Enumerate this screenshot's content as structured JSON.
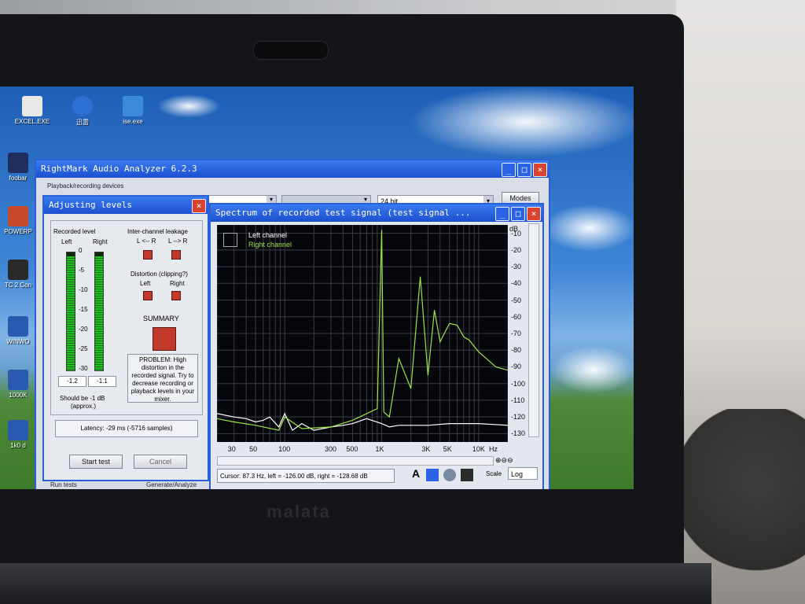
{
  "desktop_icons": [
    {
      "label": "EXCEL.EXE"
    },
    {
      "label": "迅雷"
    },
    {
      "label": "ise.exe"
    },
    {
      "label": "foobar"
    },
    {
      "label": "POWERP"
    },
    {
      "label": "TC 2 Con"
    },
    {
      "label": "WINWO"
    },
    {
      "label": "1000K"
    },
    {
      "label": "1k0 d"
    }
  ],
  "main_window": {
    "title": "RightMark Audio Analyzer 6.2.3",
    "playback_group": "Playback/recording devices",
    "bitdepth": "24 bit",
    "modes_button": "Modes",
    "run_tests": "Run tests",
    "generate_analyze": "Generate/Analyze"
  },
  "levels_window": {
    "title": "Adjusting levels",
    "recorded_level": "Recorded level",
    "left": "Left",
    "right": "Right",
    "scale": [
      "0",
      "-5",
      "-10",
      "-15",
      "-20",
      "-25",
      "-30"
    ],
    "left_value": "-1.2",
    "right_value": "-1.1",
    "left_level_fraction": 0.97,
    "right_level_fraction": 0.97,
    "should_be": "Should be  -1 dB",
    "approx": "(approx.)",
    "leakage_label": "Inter-channel leakage",
    "leak_l": "L <-- R",
    "leak_r": "L --> R",
    "distortion_label": "Distortion (clipping?)",
    "dist_left": "Left",
    "dist_right": "Right",
    "summary_label": "SUMMARY",
    "problem_text": "PROBLEM: High distortion in the recorded signal. Try to decrease recording or playback levels in your mixer.",
    "latency": "Latency: -29 ms (-5716 samples)",
    "start_button": "Start test",
    "cancel_button": "Cancel",
    "indicator_color": "#c0392b"
  },
  "spectrum_window": {
    "title": "Spectrum of recorded test signal (test signal ...",
    "legend_left": "Left channel",
    "legend_right": "Right channel",
    "db_unit": "dB",
    "hz_unit": "Hz",
    "cursor_text": "Cursor: 87.3 Hz, left = -126.00 dB, right = -128.68 dB",
    "scale_label": "Scale",
    "scale_value": "Log",
    "zoom_in": "+",
    "zoom_out": "-",
    "font_btn": "A"
  },
  "chart_data": {
    "type": "line",
    "xlabel": "Hz",
    "ylabel": "dB",
    "x_scale": "log",
    "xlim": [
      20,
      20000
    ],
    "ylim": [
      -135,
      -5
    ],
    "x_ticks": [
      "30",
      "50",
      "100",
      "300",
      "500",
      "1K",
      "3K",
      "5K",
      "10K"
    ],
    "y_ticks": [
      "-10",
      "-20",
      "-30",
      "-40",
      "-50",
      "-60",
      "-70",
      "-80",
      "-90",
      "-100",
      "-110",
      "-120",
      "-130"
    ],
    "grid": true,
    "legend": "top-left",
    "series": [
      {
        "name": "Left channel",
        "color": "#ffffff",
        "x": [
          20,
          30,
          40,
          50,
          60,
          70,
          87,
          100,
          120,
          150,
          200,
          300,
          400,
          500,
          700,
          1000,
          1200,
          1500,
          2000,
          3000,
          5000,
          10000,
          20000
        ],
        "y": [
          -118,
          -120,
          -121,
          -123,
          -122,
          -120,
          -126,
          -118,
          -128,
          -124,
          -128,
          -126,
          -125,
          -124,
          -121,
          -124,
          -126,
          -125,
          -125,
          -125,
          -124,
          -124,
          -125
        ]
      },
      {
        "name": "Right channel",
        "color": "#9be34a",
        "x": [
          20,
          30,
          50,
          87,
          100,
          150,
          300,
          500,
          700,
          900,
          1000,
          1050,
          1200,
          1500,
          2000,
          2500,
          3000,
          3500,
          4000,
          5000,
          6000,
          7000,
          8000,
          10000,
          12000,
          15000,
          20000
        ],
        "y": [
          -121,
          -123,
          -125,
          -128,
          -120,
          -127,
          -126,
          -122,
          -118,
          -115,
          -8,
          -117,
          -120,
          -85,
          -103,
          -36,
          -95,
          -56,
          -75,
          -64,
          -65,
          -72,
          -74,
          -81,
          -85,
          -90,
          -92
        ]
      }
    ]
  }
}
